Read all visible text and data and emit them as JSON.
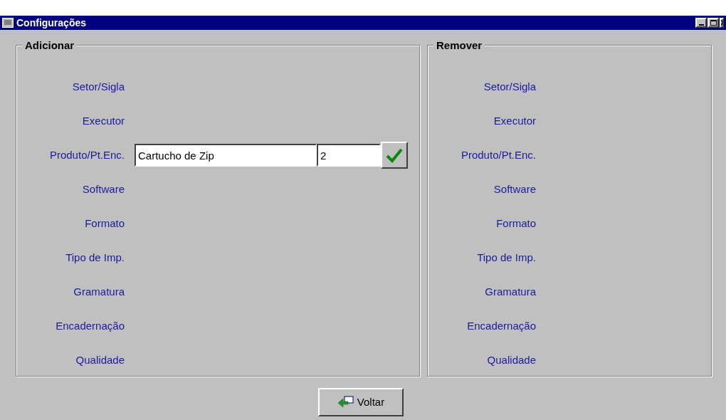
{
  "window": {
    "title": "Configurações"
  },
  "groups": [
    {
      "title": "Adicionar",
      "rows": [
        {
          "label": "Setor/Sigla"
        },
        {
          "label": "Executor"
        },
        {
          "label": "Produto/Pt.Enc.",
          "fields": [
            "Cartucho de Zip",
            "2"
          ],
          "confirm": true
        },
        {
          "label": "Software"
        },
        {
          "label": "Formato"
        },
        {
          "label": "Tipo de Imp."
        },
        {
          "label": "Gramatura"
        },
        {
          "label": "Encadernação"
        },
        {
          "label": "Qualidade"
        }
      ]
    },
    {
      "title": "Remover",
      "rows": [
        {
          "label": "Setor/Sigla"
        },
        {
          "label": "Executor"
        },
        {
          "label": "Produto/Pt.Enc."
        },
        {
          "label": "Software"
        },
        {
          "label": "Formato"
        },
        {
          "label": "Tipo de Imp."
        },
        {
          "label": "Gramatura"
        },
        {
          "label": "Encadernação"
        },
        {
          "label": "Qualidade"
        }
      ]
    }
  ],
  "back_button": {
    "label": "Voltar"
  }
}
